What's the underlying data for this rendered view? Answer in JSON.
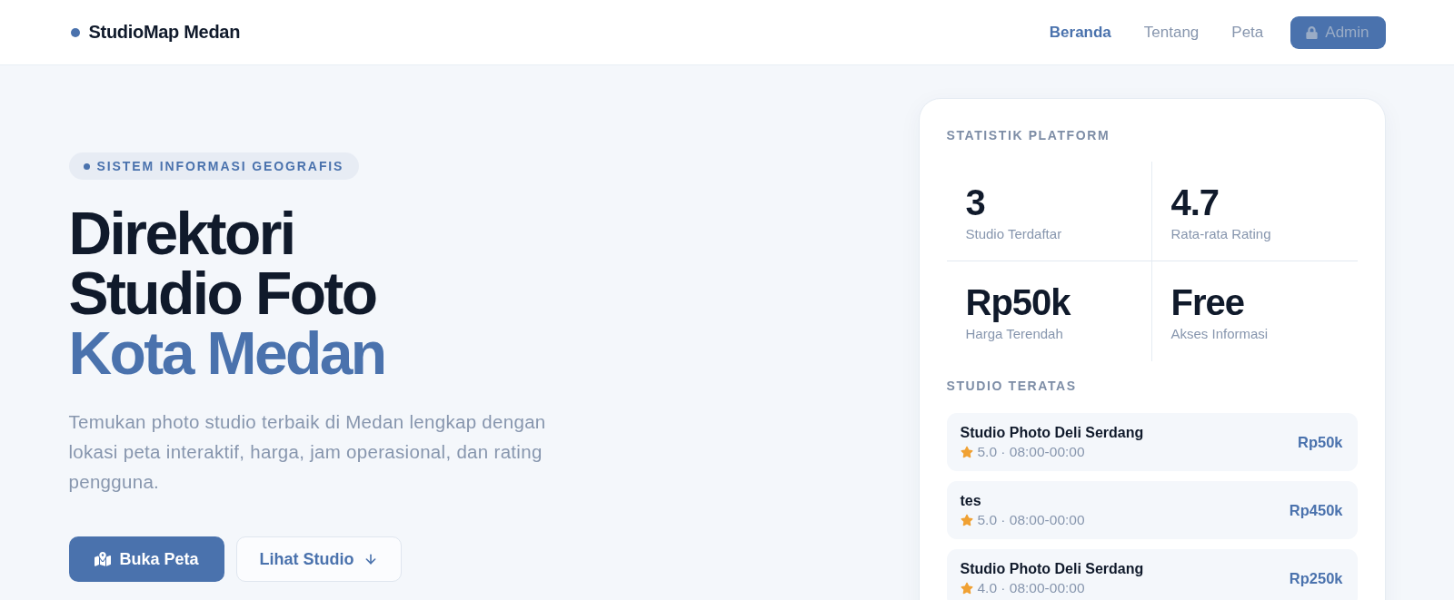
{
  "header": {
    "brand": "StudioMap Medan",
    "nav": [
      {
        "label": "Beranda",
        "selected": true
      },
      {
        "label": "Tentang",
        "selected": false
      },
      {
        "label": "Peta",
        "selected": false
      }
    ],
    "admin_button": "Admin"
  },
  "hero": {
    "badge": "SISTEM INFORMASI GEOGRAFIS",
    "title": [
      {
        "text": "Direktori",
        "accent": false
      },
      {
        "text": "Studio Foto",
        "accent": false
      },
      {
        "text": "Kota Medan",
        "accent": true
      }
    ],
    "description": "Temukan photo studio terbaik di Medan lengkap dengan lokasi peta interaktif, harga, jam operasional, dan rating pengguna.",
    "buttons": [
      {
        "label": "Buka Peta",
        "kind": "primary"
      },
      {
        "label": "Lihat Studio",
        "kind": "outline"
      }
    ]
  },
  "stats_panel": {
    "title": "STATISTIK PLATFORM",
    "stats": [
      {
        "value": "3",
        "label": "Studio Terdaftar"
      },
      {
        "value": "4.7",
        "label": "Rata-rata Rating"
      },
      {
        "value": "Rp50k",
        "label": "Harga Terendah"
      },
      {
        "value": "Free",
        "label": "Akses Informasi"
      }
    ],
    "top_title": "STUDIO TERATAS",
    "top_studios": [
      {
        "name": "Studio Photo Deli Serdang",
        "meta": "5.0 · 08:00-00:00",
        "price": "Rp50k"
      },
      {
        "name": "tes",
        "meta": "5.0 · 08:00-00:00",
        "price": "Rp450k"
      },
      {
        "name": "Studio Photo Deli Serdang",
        "meta": "4.0 · 08:00-00:00",
        "price": "Rp250k"
      }
    ]
  }
}
